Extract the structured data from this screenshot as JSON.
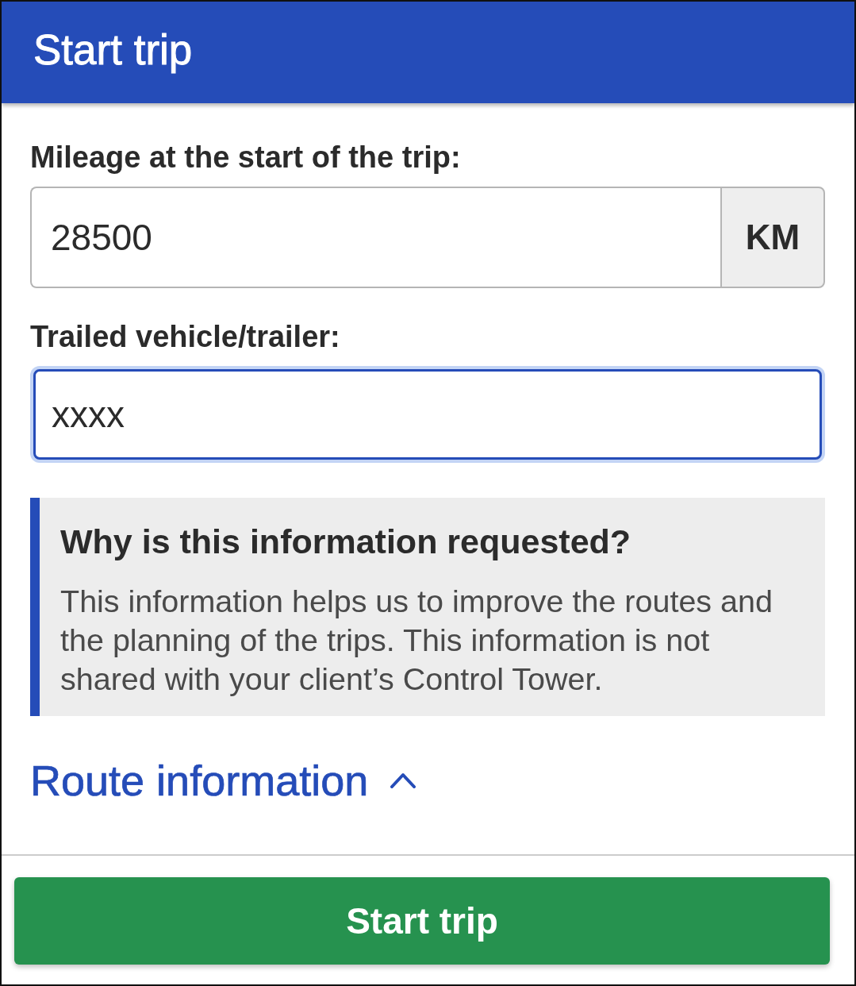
{
  "header": {
    "title": "Start trip"
  },
  "fields": [
    {
      "label": "Mileage at the start of the trip:",
      "value": "28500",
      "unit": "KM",
      "focused": false
    },
    {
      "label": "Trailed vehicle/trailer:",
      "value": "xxxx",
      "focused": true
    }
  ],
  "info": {
    "title": "Why is this information requested?",
    "text": "This information helps us to improve the routes and the planning of the trips. This information is not shared with your client’s Control Tower."
  },
  "route_section": {
    "label": "Route information",
    "expanded": true
  },
  "footer": {
    "button": "Start trip"
  }
}
